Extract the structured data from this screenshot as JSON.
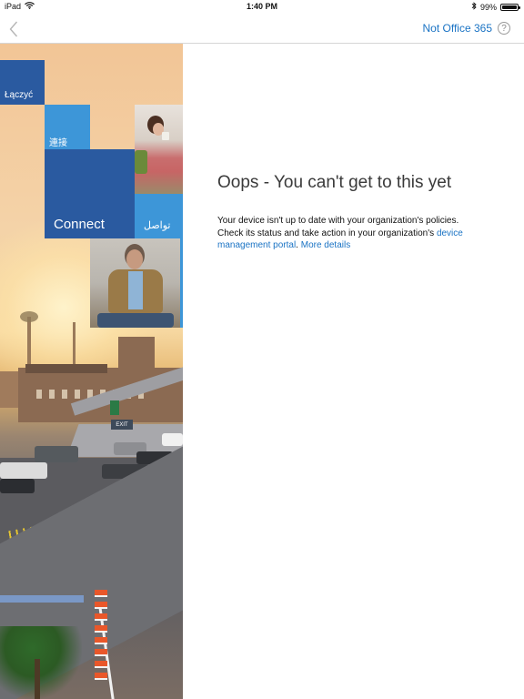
{
  "status_bar": {
    "device": "iPad",
    "time": "1:40 PM",
    "battery_percent": "99%",
    "battery_level": 0.99
  },
  "nav": {
    "right_link": "Not Office 365",
    "help_symbol": "?"
  },
  "hero": {
    "tiles": {
      "polish": "Łączyć",
      "chinese": "連接",
      "english": "Connect",
      "arabic": "تواصل"
    },
    "sign_exit": "EXIT"
  },
  "main": {
    "headline": "Oops - You can't get to this yet",
    "message_line_1": "Your device isn't up to date with your organization's policies.",
    "message_line_2": "Check its status and take action in your organization's",
    "link_portal_part1": "device",
    "link_portal_part2": "management portal",
    "period": ".",
    "link_details": "More details"
  },
  "colors": {
    "accent": "#1a73c4",
    "tile_dark_blue": "#2a5aa0",
    "tile_light_blue": "#3d96d8"
  },
  "icons": [
    "wifi-icon",
    "bluetooth-icon",
    "battery-icon",
    "back-chevron-icon",
    "help-icon"
  ]
}
